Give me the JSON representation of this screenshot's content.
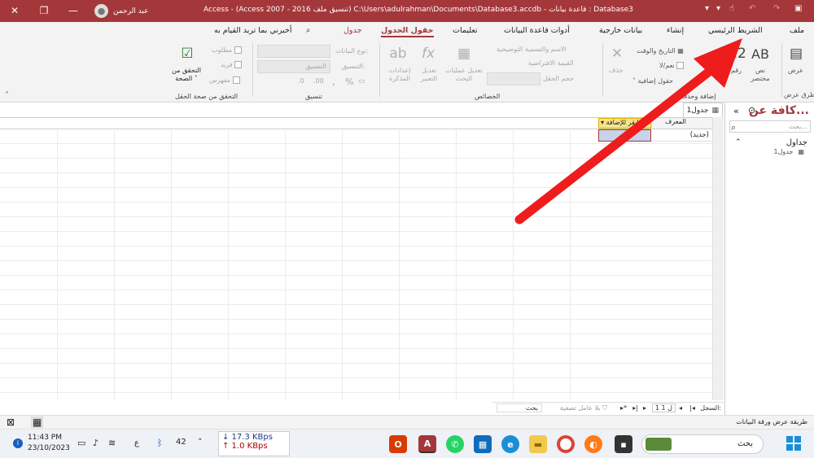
{
  "titlebar": {
    "title": "Access  -  (Access 2007 - 2016 تنسيق ملف) C:\\Users\\adulrahman\\Documents\\Database3.accdb - قاعدة بيانات : Database3",
    "user_name": "عبد الرحمن",
    "close_glyph": "✕",
    "restore_glyph": "❐",
    "minimize_glyph": "—"
  },
  "tabs": [
    {
      "label": "ملف"
    },
    {
      "label": "الشريط الرئيسي"
    },
    {
      "label": "إنشاء"
    },
    {
      "label": "بيانات خارجية"
    },
    {
      "label": "أدوات قاعدة البيانات"
    },
    {
      "label": "تعليمات"
    },
    {
      "label": "حقول الجدول"
    },
    {
      "label": "جدول"
    }
  ],
  "tell_me": "أخبرني بما تريد القيام به",
  "ribbon": {
    "views": {
      "button": "عرض",
      "group": "طرق عرض"
    },
    "add_delete": {
      "short_text": "نص مختصر",
      "number": "رقم",
      "date_time": "التاريخ والوقت",
      "yes_no": "نعم/لا",
      "more_fields": "حقول إضافية",
      "delete": "حذف",
      "group": "إضافة وحذف"
    },
    "properties": {
      "name_caption": "الاسم والتسمية التوضيحية",
      "default_value": "القيمة الافتراضية",
      "field_size": "حجم الحقل",
      "modify_lookups": "تعديل عمليات البحث",
      "modify_expression": "تعديل التعبير",
      "memo_settings": "إعدادات المذكرة",
      "group": "الخصائص"
    },
    "formatting": {
      "data_type": "نوع البيانات:",
      "format": "التنسيق:",
      "format_value": "التنسيق",
      "group": "تنسيق"
    },
    "validation": {
      "required": "مطلوب",
      "unique": "فريد",
      "indexed": "مفهرس",
      "validate": "التحقق من الصحة",
      "group": "التحقق من صحة الحقل"
    }
  },
  "nav": {
    "title": "كافة عن...",
    "search_placeholder": "بحث...",
    "section": "جداول",
    "item": "جدول1"
  },
  "document": {
    "tab_label": "جدول1",
    "col_id": "المعرف",
    "col_add": "انقر للإضافة",
    "new_row": "(جديد)"
  },
  "record_nav": {
    "label": "السجل:",
    "position": "1 ل 1",
    "filter": "بلا عامل تصفية",
    "search": "بحث"
  },
  "status": {
    "text": "طريقة عرض ورقة البيانات"
  },
  "taskbar": {
    "time": "11:43 PM",
    "date": "23/10/2023",
    "download": "↓ 17.3 KBps",
    "upload": "↑ 1.0 KBps",
    "search": "بحث",
    "battery": "42",
    "lang": "ع"
  }
}
